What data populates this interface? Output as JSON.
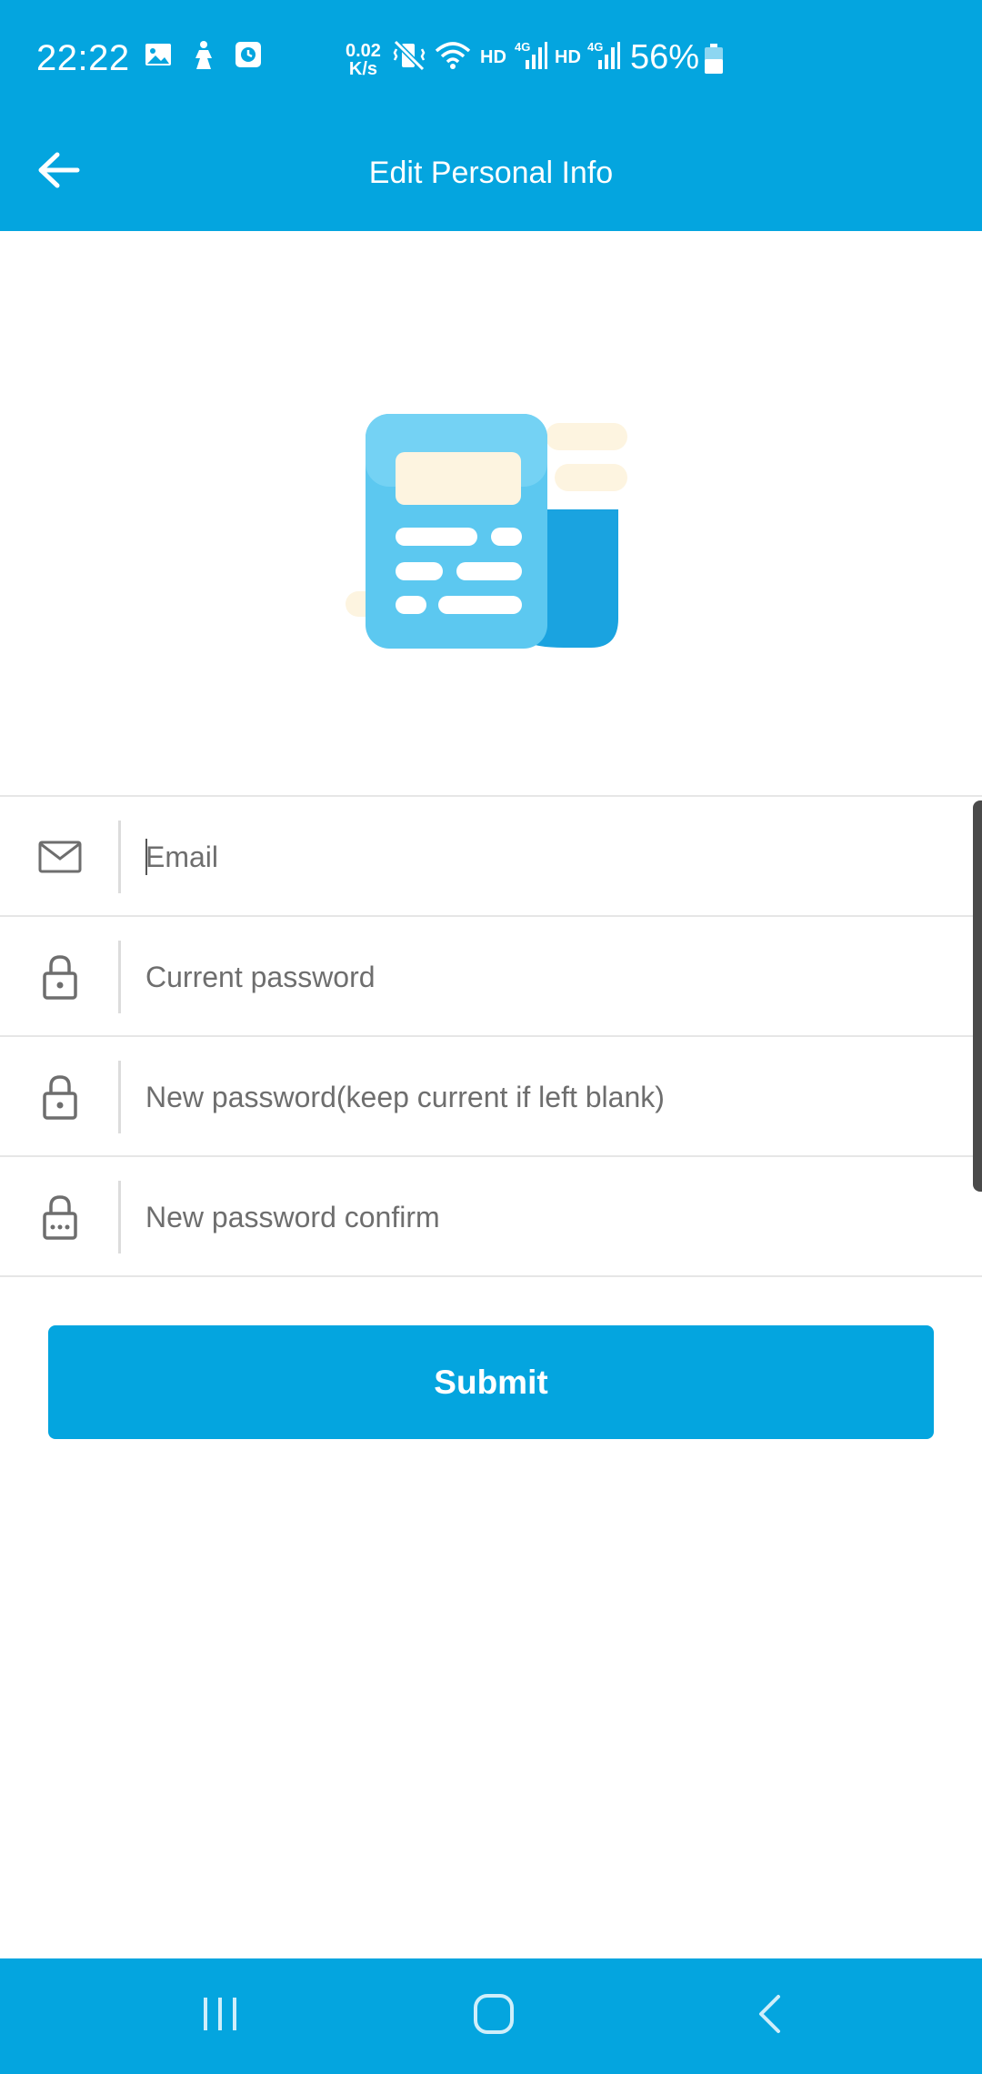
{
  "status_bar": {
    "time": "22:22",
    "net_speed_value": "0.02",
    "net_speed_unit": "K/s",
    "hd_label_1": "HD",
    "hd_label_2": "HD",
    "network_1": "4G",
    "network_2": "4G",
    "battery": "56%",
    "icons": [
      "image-icon",
      "accessibility-icon",
      "clock-app-icon",
      "mute-vibrate-icon",
      "wifi-icon",
      "signal-icon",
      "battery-icon"
    ]
  },
  "appbar": {
    "title": "Edit Personal Info",
    "back_icon": "arrow-left-icon"
  },
  "form": {
    "fields": [
      {
        "icon": "mail-icon",
        "placeholder": "Email",
        "value": ""
      },
      {
        "icon": "lock-icon",
        "placeholder": "Current password",
        "value": ""
      },
      {
        "icon": "lock-icon",
        "placeholder": "New password(keep current if left blank)",
        "value": ""
      },
      {
        "icon": "lock-dots-icon",
        "placeholder": "New password confirm",
        "value": ""
      }
    ],
    "submit_label": "Submit"
  },
  "nav_bar": {
    "icons": [
      "recent-apps-icon",
      "home-icon",
      "back-nav-icon"
    ]
  },
  "colors": {
    "primary": "#04a5df",
    "illustration_blue": "#5cc8f0",
    "illustration_cream": "#fdf4e0",
    "icon_gray": "#6e6e6e"
  }
}
